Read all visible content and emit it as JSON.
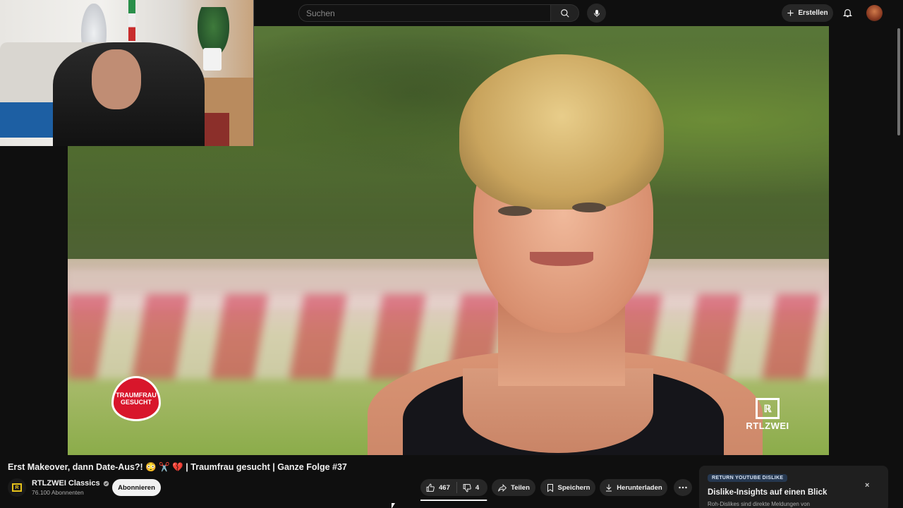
{
  "header": {
    "search_placeholder": "Suchen",
    "create_label": "Erstellen",
    "icons": [
      "search-icon",
      "mic-icon",
      "plus-icon",
      "bell-icon"
    ]
  },
  "video": {
    "show_logo_text": "TRAUMFRAU GESUCHT",
    "channel_bug_text": "RTLZWEI"
  },
  "info": {
    "title": "Erst Makeover, dann Date-Aus?! 😳 ✂️ 💔 | Traumfrau gesucht | Ganze Folge #37",
    "channel_name": "RTLZWEI Classics",
    "subscribers": "76.100 Abonnenten",
    "subscribe_label": "Abonnieren",
    "likes": "467",
    "dislikes": "4",
    "like_ratio": 0.99,
    "share_label": "Teilen",
    "save_label": "Speichern",
    "download_label": "Herunterladen"
  },
  "ryd": {
    "badge": "RETURN YOUTUBE DISLIKE",
    "title": "Dislike-Insights auf einen Blick",
    "subtitle": "Roh-Dislikes sind direkte Meldungen von",
    "close": "×"
  },
  "colors": {
    "background": "#0f0f0f",
    "pill": "#272727",
    "text": "#f1f1f1",
    "subscribe_bg": "#f1f1f1"
  }
}
